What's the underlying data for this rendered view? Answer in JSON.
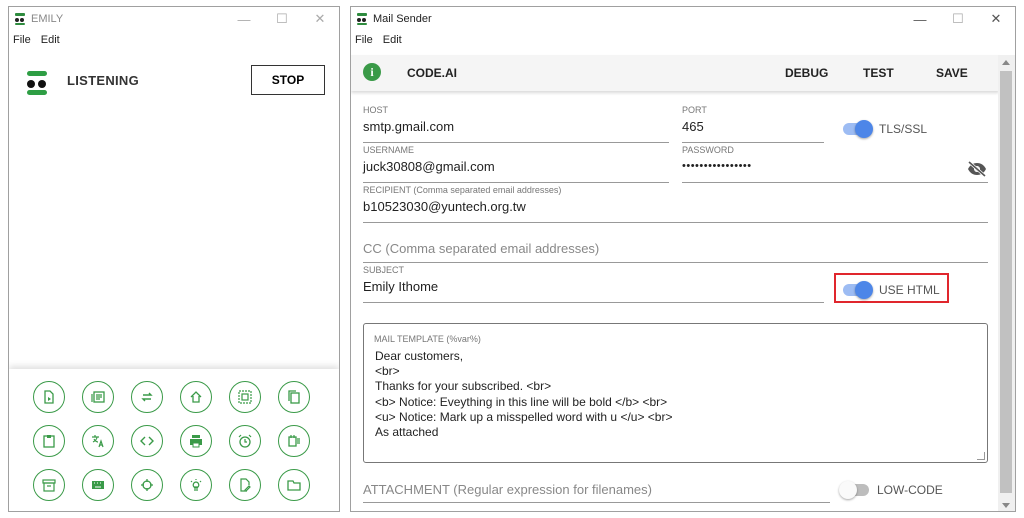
{
  "emily_window": {
    "title": "EMILY",
    "menu": [
      "File",
      "Edit"
    ],
    "status": "LISTENING",
    "stop_label": "STOP",
    "accent_color": "#2e9e44",
    "tools": [
      {
        "icon": "document-icon"
      },
      {
        "icon": "list-icon"
      },
      {
        "icon": "repeat-icon"
      },
      {
        "icon": "home-icon"
      },
      {
        "icon": "select-all-icon"
      },
      {
        "icon": "copy-icon"
      },
      {
        "icon": "clipboard-icon"
      },
      {
        "icon": "translate-icon"
      },
      {
        "icon": "code-icon"
      },
      {
        "icon": "print-icon"
      },
      {
        "icon": "alarm-icon"
      },
      {
        "icon": "calendar-list-icon"
      },
      {
        "icon": "archive-icon"
      },
      {
        "icon": "keyboard-icon"
      },
      {
        "icon": "crosshair-icon"
      },
      {
        "icon": "lightbulb-icon"
      },
      {
        "icon": "edit-document-icon"
      },
      {
        "icon": "folder-icon"
      }
    ]
  },
  "mail_window": {
    "title": "Mail Sender",
    "menu": [
      "File",
      "Edit"
    ],
    "toolbar": {
      "brand": "CODE.AI",
      "debug": "DEBUG",
      "test": "TEST",
      "save": "SAVE"
    },
    "host": {
      "label": "HOST",
      "value": "smtp.gmail.com"
    },
    "port": {
      "label": "PORT",
      "value": "465"
    },
    "tls_toggle": {
      "label": "TLS/SSL",
      "on": true
    },
    "username": {
      "label": "USERNAME",
      "value": "juck30808@gmail.com"
    },
    "password": {
      "label": "PASSWORD",
      "value": "••••••••••••••••"
    },
    "recipient": {
      "label": "RECIPIENT (Comma separated email addresses)",
      "value": "b10523030@yuntech.org.tw"
    },
    "cc": {
      "placeholder": "CC (Comma separated email addresses)"
    },
    "subject": {
      "label": "SUBJECT",
      "value": "Emily Ithome"
    },
    "html_toggle": {
      "label": "USE HTML",
      "on": true
    },
    "template": {
      "label": "MAIL TEMPLATE (%var%)",
      "lines": [
        "Dear customers,",
        "<br>",
        "Thanks for your subscribed. <br>",
        "<b> Notice: Eveything in this line will be bold </b> <br>",
        "<u> Notice: Mark up a misspelled word with u  </u> <br>",
        "As attached"
      ]
    },
    "attachment": {
      "placeholder": "ATTACHMENT (Regular expression for filenames)"
    },
    "lowcode_toggle": {
      "label": "LOW-CODE",
      "on": false
    },
    "colors": {
      "toggle_on": "#4d86e8",
      "info": "#3a9a48",
      "highlight": "#e0262d"
    }
  }
}
